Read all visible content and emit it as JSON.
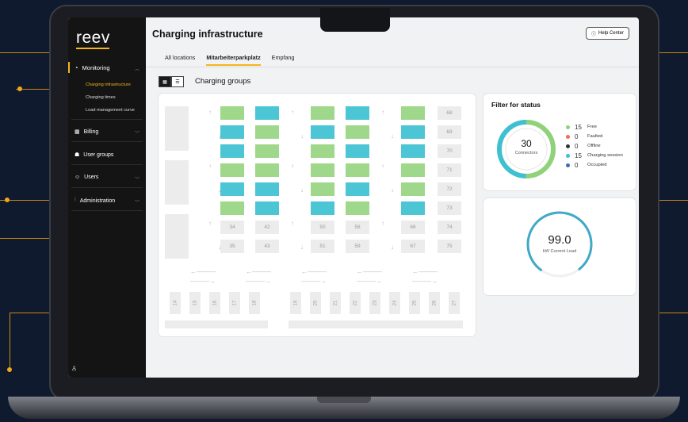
{
  "app": {
    "logo": "reev"
  },
  "sidebar": {
    "items": [
      {
        "label": "Monitoring",
        "icon": "monitoring-icon"
      },
      {
        "label": "Billing",
        "icon": "billing-icon"
      },
      {
        "label": "User groups",
        "icon": "user-groups-icon"
      },
      {
        "label": "Users",
        "icon": "users-icon"
      },
      {
        "label": "Administration",
        "icon": "administration-icon"
      }
    ],
    "sub_items": [
      "Charging infrastructure",
      "Charging times",
      "Load management curve"
    ]
  },
  "header": {
    "title": "Charging infrastructure",
    "help_label": "Help Center"
  },
  "tabs": [
    "All locations",
    "Mitarbeiterparkplatz",
    "Empfang"
  ],
  "active_tab": "Mitarbeiterparkplatz",
  "groups_title": "Charging groups",
  "lot": {
    "right_column": [
      "68",
      "69",
      "70",
      "71",
      "72",
      "73",
      "74",
      "75"
    ],
    "bottom_rows": [
      [
        "34",
        "42",
        "50",
        "58",
        "66"
      ],
      [
        "35",
        "43",
        "51",
        "59",
        "67"
      ]
    ],
    "bottom_spots_left": [
      "14",
      "15",
      "16",
      "17",
      "18"
    ],
    "bottom_spots_right": [
      "19",
      "20",
      "21",
      "22",
      "23",
      "24",
      "25",
      "26",
      "27"
    ]
  },
  "status": {
    "title": "Filter for status",
    "total": "30",
    "total_label": "Connectors",
    "items": [
      {
        "count": "15",
        "label": "Free",
        "color": "#8fd27a"
      },
      {
        "count": "0",
        "label": "Faulted",
        "color": "#f26b5b"
      },
      {
        "count": "0",
        "label": "Offline",
        "color": "#333333"
      },
      {
        "count": "15",
        "label": "Charging session",
        "color": "#3fc0d0"
      },
      {
        "count": "0",
        "label": "Occupied",
        "color": "#3b6fb0"
      }
    ]
  },
  "load": {
    "value": "99.0",
    "label": "kW Current Load",
    "fraction": 0.99
  }
}
